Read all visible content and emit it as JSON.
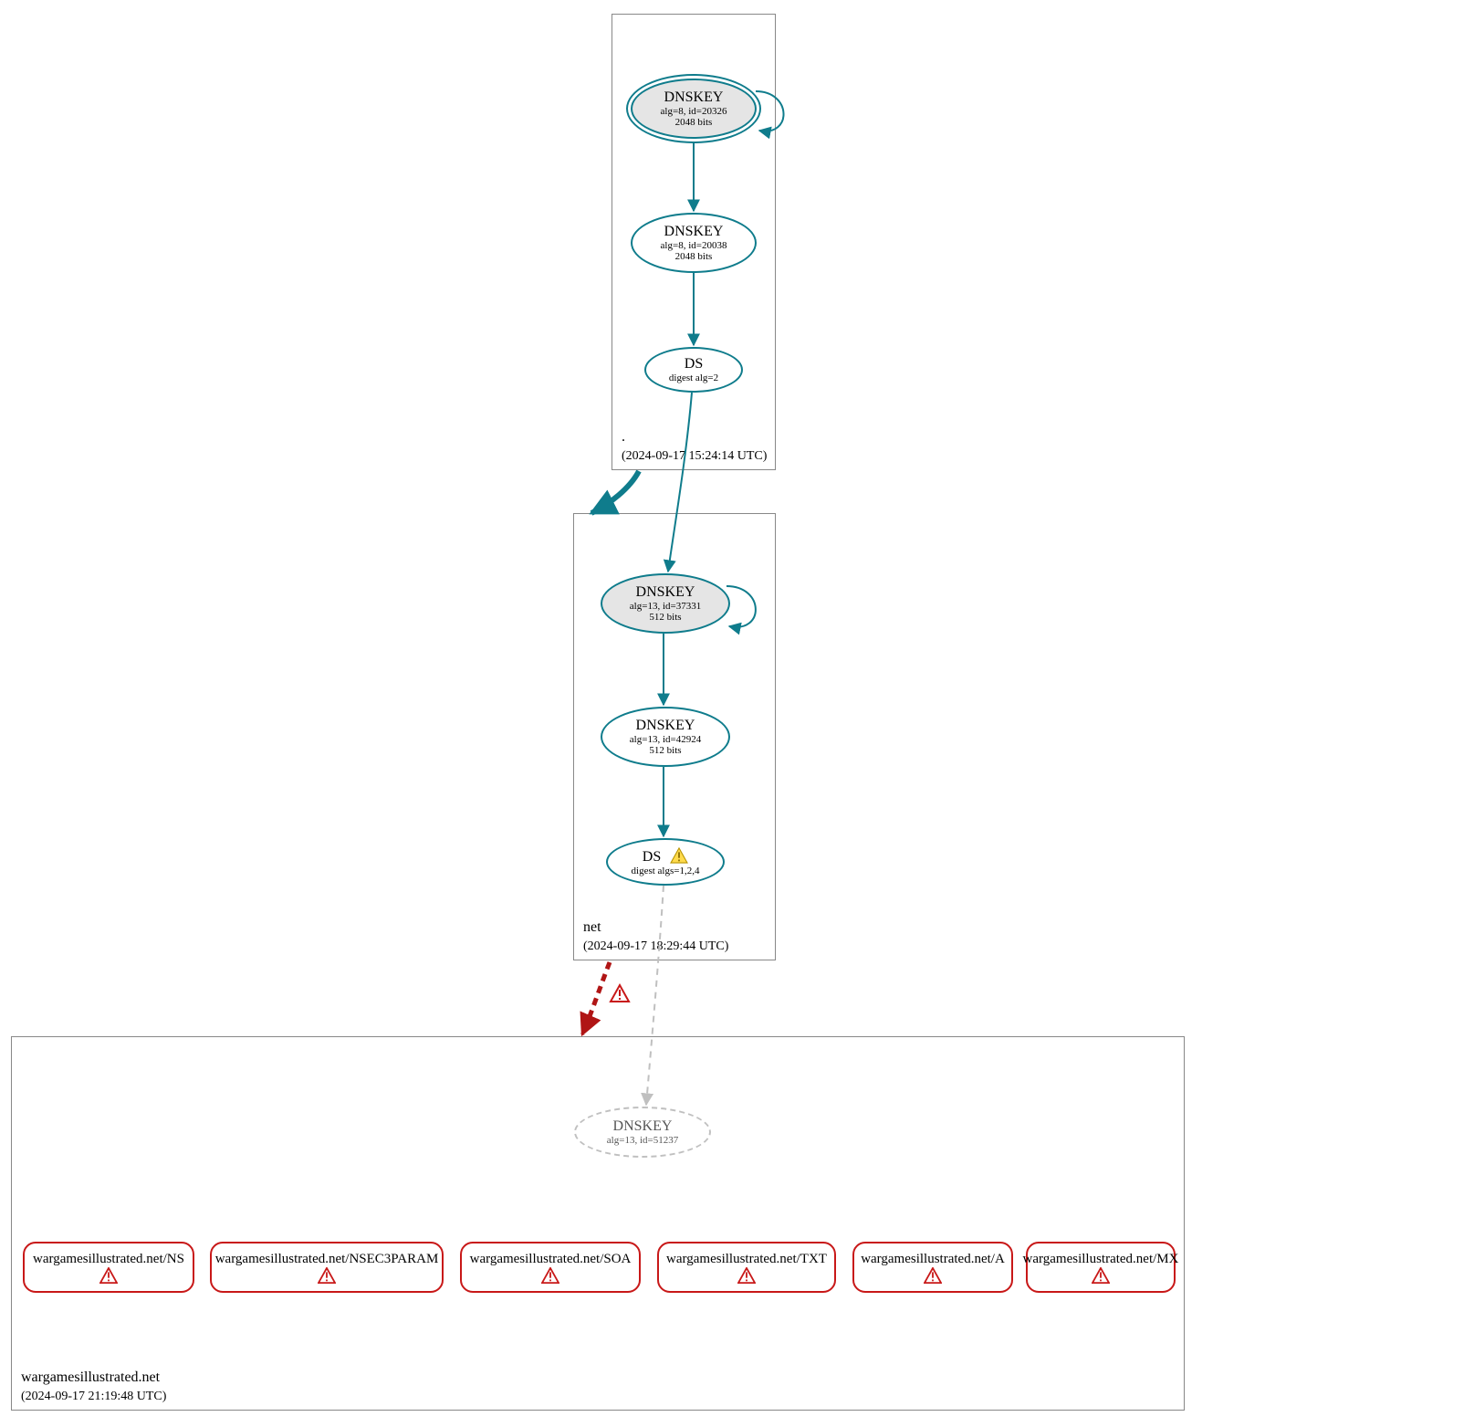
{
  "colors": {
    "teal": "#0f7c8c",
    "red": "#c81818",
    "gray": "#c0c0c0"
  },
  "zones": {
    "root": {
      "name": ".",
      "timestamp": "(2024-09-17 15:24:14 UTC)",
      "nodes": {
        "ksk": {
          "title": "DNSKEY",
          "line2": "alg=8, id=20326",
          "line3": "2048 bits"
        },
        "zsk": {
          "title": "DNSKEY",
          "line2": "alg=8, id=20038",
          "line3": "2048 bits"
        },
        "ds": {
          "title": "DS",
          "line2": "digest alg=2"
        }
      }
    },
    "net": {
      "name": "net",
      "timestamp": "(2024-09-17 18:29:44 UTC)",
      "nodes": {
        "ksk": {
          "title": "DNSKEY",
          "line2": "alg=13, id=37331",
          "line3": "512 bits"
        },
        "zsk": {
          "title": "DNSKEY",
          "line2": "alg=13, id=42924",
          "line3": "512 bits"
        },
        "ds": {
          "title": "DS",
          "line2": "digest algs=1,2,4",
          "warning": true
        }
      }
    },
    "domain": {
      "name": "wargamesillustrated.net",
      "timestamp": "(2024-09-17 21:19:48 UTC)",
      "nodes": {
        "dnskey": {
          "title": "DNSKEY",
          "line2": "alg=13, id=51237"
        }
      },
      "records": [
        "wargamesillustrated.net/NS",
        "wargamesillustrated.net/NSEC3PARAM",
        "wargamesillustrated.net/SOA",
        "wargamesillustrated.net/TXT",
        "wargamesillustrated.net/A",
        "wargamesillustrated.net/MX"
      ]
    }
  }
}
